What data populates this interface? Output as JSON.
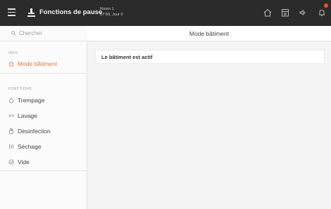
{
  "topbar": {
    "title": "Fonctions de pause",
    "room_line1": "Room 1",
    "room_line2": "07:50, Jour 0"
  },
  "sidebar": {
    "search_placeholder": "Chercher",
    "info_section": "INFO",
    "info_items": [
      {
        "label": "Mode bâtiment",
        "icon": "building-icon",
        "active": true
      }
    ],
    "functions_section": "FONCTIONS",
    "function_items": [
      {
        "label": "Trempage",
        "icon": "droplet-icon"
      },
      {
        "label": "Lavage",
        "icon": "wash-icon"
      },
      {
        "label": "Désinfection",
        "icon": "disinfection-icon"
      },
      {
        "label": "Séchage",
        "icon": "drying-icon"
      },
      {
        "label": "Vide",
        "icon": "empty-icon"
      }
    ]
  },
  "main": {
    "header_title": "Mode bâtiment",
    "status_text": "Le bâtiment est actif"
  },
  "colors": {
    "topbar_bg": "#2b2b2b",
    "accent": "#e37640",
    "alert": "#e8522f",
    "content_bg": "#f4f4f4"
  }
}
